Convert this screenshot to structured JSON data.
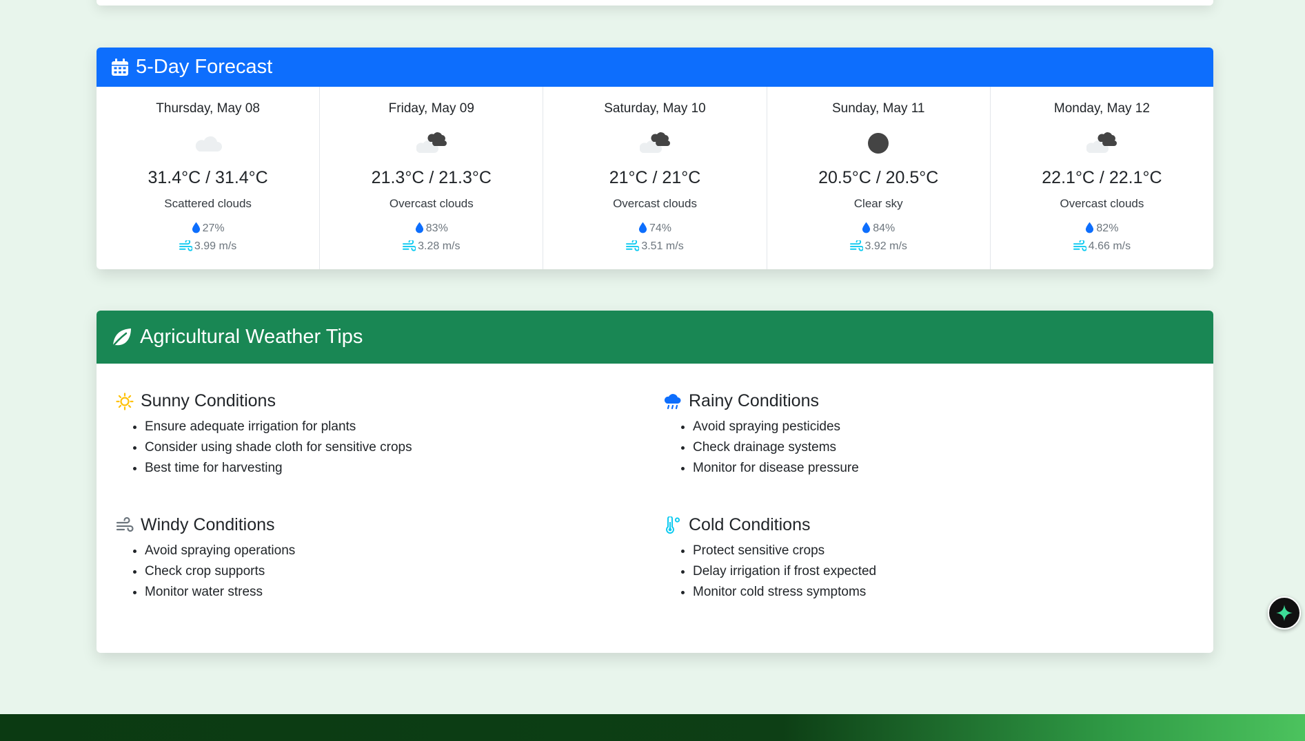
{
  "forecast": {
    "title": "5-Day Forecast",
    "days": [
      {
        "date": "Thursday, May 08",
        "icon": "scattered-clouds-icon",
        "temp": "31.4°C / 31.4°C",
        "desc": "Scattered clouds",
        "humidity": "27%",
        "wind": "3.99 m/s"
      },
      {
        "date": "Friday, May 09",
        "icon": "overcast-clouds-icon",
        "temp": "21.3°C / 21.3°C",
        "desc": "Overcast clouds",
        "humidity": "83%",
        "wind": "3.28 m/s"
      },
      {
        "date": "Saturday, May 10",
        "icon": "overcast-clouds-icon",
        "temp": "21°C / 21°C",
        "desc": "Overcast clouds",
        "humidity": "74%",
        "wind": "3.51 m/s"
      },
      {
        "date": "Sunday, May 11",
        "icon": "clear-sky-icon",
        "temp": "20.5°C / 20.5°C",
        "desc": "Clear sky",
        "humidity": "84%",
        "wind": "3.92 m/s"
      },
      {
        "date": "Monday, May 12",
        "icon": "overcast-clouds-icon",
        "temp": "22.1°C / 22.1°C",
        "desc": "Overcast clouds",
        "humidity": "82%",
        "wind": "4.66 m/s"
      }
    ]
  },
  "tips": {
    "title": "Agricultural Weather Tips",
    "sunny": {
      "title": "Sunny Conditions",
      "items": [
        "Ensure adequate irrigation for plants",
        "Consider using shade cloth for sensitive crops",
        "Best time for harvesting"
      ]
    },
    "rainy": {
      "title": "Rainy Conditions",
      "items": [
        "Avoid spraying pesticides",
        "Check drainage systems",
        "Monitor for disease pressure"
      ]
    },
    "windy": {
      "title": "Windy Conditions",
      "items": [
        "Avoid spraying operations",
        "Check crop supports",
        "Monitor water stress"
      ]
    },
    "cold": {
      "title": "Cold Conditions",
      "items": [
        "Protect sensitive crops",
        "Delay irrigation if frost expected",
        "Monitor cold stress symptoms"
      ]
    }
  },
  "colors": {
    "forecast_header": "#0d6efd",
    "tips_header": "#198754",
    "page_background": "#e8f5ec",
    "humidity_icon": "#0d6efd",
    "wind_icon": "#0dcaf0",
    "sunny_icon": "#ffc107"
  }
}
